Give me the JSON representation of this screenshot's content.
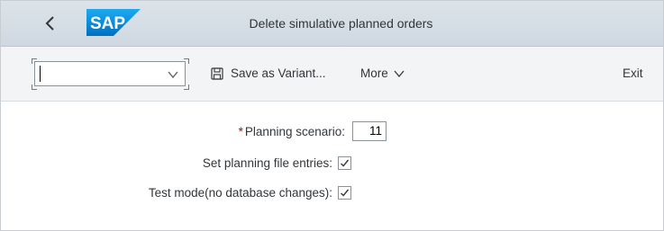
{
  "header": {
    "title": "Delete simulative planned orders",
    "logo_text": "SAP",
    "back_icon": "chevron-left-icon"
  },
  "toolbar": {
    "variant_input_value": "",
    "save_variant_label": "Save as Variant...",
    "more_label": "More",
    "exit_label": "Exit"
  },
  "form": {
    "planning_scenario_label": "Planning scenario:",
    "planning_scenario_required": "*",
    "planning_scenario_value": "11",
    "set_planning_label": "Set planning file entries:",
    "set_planning_checked": true,
    "test_mode_label": "Test mode(no database changes):",
    "test_mode_checked": true
  },
  "colors": {
    "shell_bg": "#d5dde6",
    "toolbar_bg": "#f2f4f6",
    "required": "#bb0000",
    "brand_blue": "#0a6ed1"
  }
}
